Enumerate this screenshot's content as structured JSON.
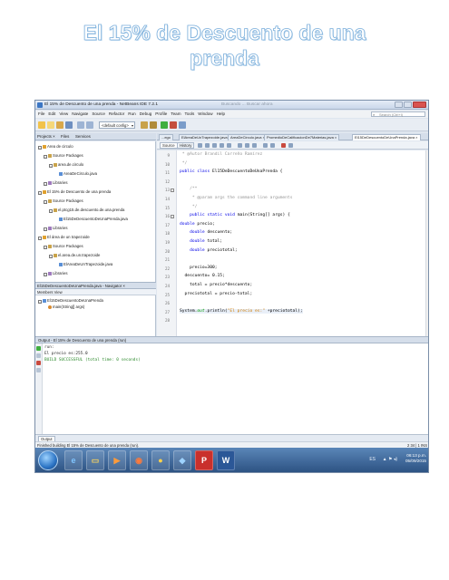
{
  "document": {
    "title_line1": "El 15% de Descuento de una",
    "title_line2": "prenda"
  },
  "window": {
    "title": "El 15% de Descuento de una prenda - NetBeans IDE 7.2.1",
    "caption_blur": "Buscando ... Buscar ahora"
  },
  "menu": {
    "items": [
      "File",
      "Edit",
      "View",
      "Navigate",
      "Source",
      "Refactor",
      "Run",
      "Debug",
      "Profile",
      "Team",
      "Tools",
      "Window",
      "Help"
    ],
    "search_placeholder": "Search (Ctrl+I)"
  },
  "toolbar": {
    "config_value": "<default config>"
  },
  "projects_panel": {
    "tab_projects": "Projects ×",
    "tab_files": "Files",
    "tab_services": "Services",
    "tree": [
      {
        "label": "Area de circulo",
        "level": 0,
        "icon": "proj"
      },
      {
        "label": "Source Packages",
        "level": 1,
        "icon": "pkg"
      },
      {
        "label": "area.de.circulo",
        "level": 2,
        "icon": "pkg"
      },
      {
        "label": "AreaDeCirculo.java",
        "level": 3,
        "icon": "java"
      },
      {
        "label": "Libraries",
        "level": 1,
        "icon": "lib"
      },
      {
        "label": "El 15% de Descuento de una prenda",
        "level": 0,
        "icon": "proj"
      },
      {
        "label": "Source Packages",
        "level": 1,
        "icon": "pkg"
      },
      {
        "label": "el.ptcg15.de.descuento.de.una.prenda",
        "level": 2,
        "icon": "pkg"
      },
      {
        "label": "El15DeDescuentoDeUnaPrenda.java",
        "level": 3,
        "icon": "java"
      },
      {
        "label": "Libraries",
        "level": 1,
        "icon": "lib"
      },
      {
        "label": "El área de un trapezoide",
        "level": 0,
        "icon": "proj"
      },
      {
        "label": "Source Packages",
        "level": 1,
        "icon": "pkg"
      },
      {
        "label": "el.area.de.un.trapezoide",
        "level": 2,
        "icon": "pkg"
      },
      {
        "label": "ElAreaDeUnTrapezoide.java",
        "level": 3,
        "icon": "java"
      },
      {
        "label": "Libraries",
        "level": 1,
        "icon": "lib"
      }
    ]
  },
  "navigator": {
    "title": "El15DeDescuentoDeUnaPrenda.java - Navigator ×",
    "members_label": "Members View",
    "items": [
      "El15DeDescuentoDeUnaPrenda",
      "main(String[] args)"
    ]
  },
  "editor": {
    "tabs": [
      "...ego",
      "ElAreaDeUnTrapezoide.java ×",
      "AreaDeCirculo.java ×",
      "PromedioDeCalificacionDe7Materias.java ×",
      "El15DeDescuentoDeUnaPrenda.java ×"
    ],
    "source_tab": "Source",
    "history_tab": "History",
    "line_numbers": [
      "9",
      "10",
      "11",
      "12",
      "13",
      "14",
      "15",
      "16",
      "17",
      "18",
      "19",
      "20",
      "21",
      "22",
      "23",
      "24",
      "25",
      "26",
      "27",
      "28"
    ],
    "lines": [
      " * @Autor Brandil Carreño Ramírez",
      " */",
      "public class El15DeDescuentoDeUnaPrenda {",
      "",
      "    /**",
      "     * @param args the command line arguments",
      "     */",
      "    public static void main(String[] args) {",
      "double precio;",
      "    double descuento;",
      "    double total;",
      "    double preciototal;",
      "",
      "    precio=300;",
      "  descuento= 0.15;",
      "    total = precio*descuento;",
      "  preciototal = precio-total;",
      "",
      "System.out.println(\"El precio es:\" +preciototal);",
      ""
    ]
  },
  "output": {
    "title": "Output - El 15% de Descuento de una prenda (run)",
    "lines": [
      "run:",
      "El precio es:255.0",
      "BUILD SUCCESSFUL (total time: 0 seconds)"
    ]
  },
  "bottom_tab": {
    "label": "Output"
  },
  "status": {
    "left": "Finished building El 15% de Descuento de una prenda (run).",
    "right": "2    34 | 1    INS"
  },
  "taskbar": {
    "time": "06:13 p.m.",
    "date": "05/09/2015",
    "lang": "ES"
  },
  "colors": {
    "title_outline": "#7fb1dc",
    "keyword": "#0000e6",
    "comment": "#969696",
    "string": "#ce7b00",
    "success": "#2e8b2e",
    "taskbar": "#2a4f7f"
  }
}
